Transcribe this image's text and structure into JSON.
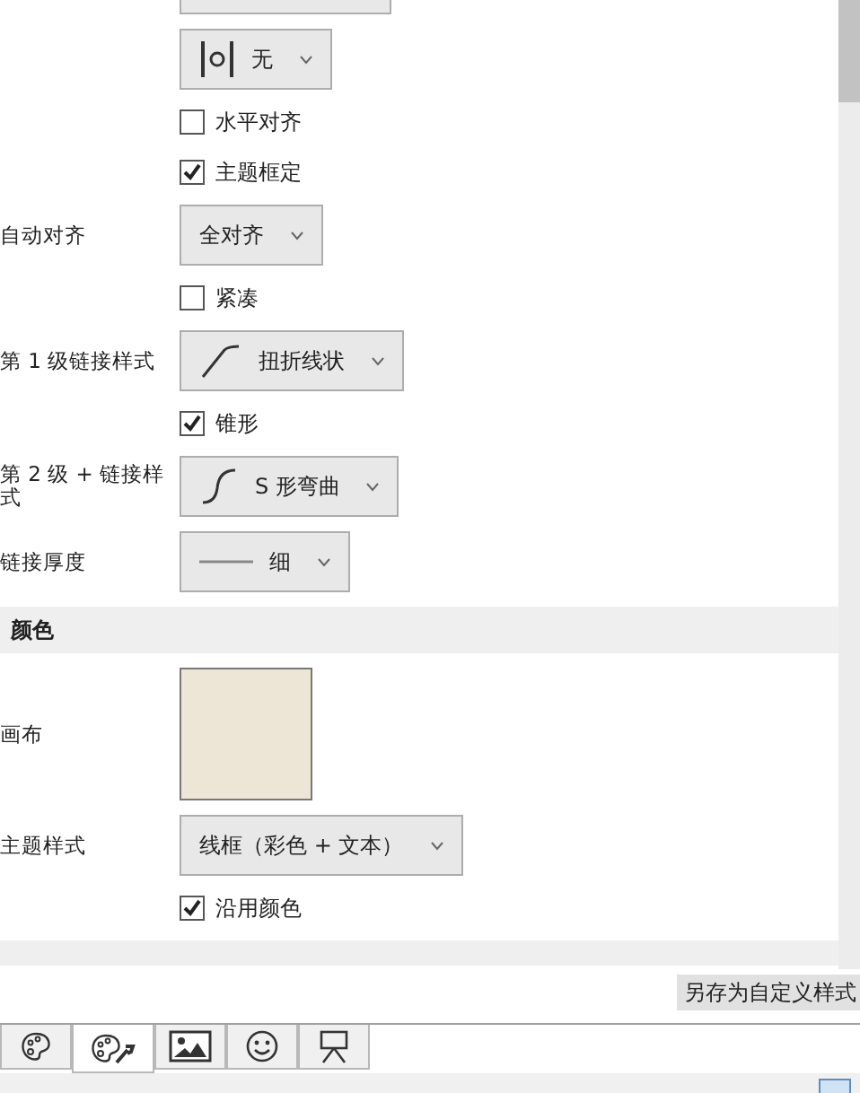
{
  "rows": [
    {
      "kind": "stub"
    },
    {
      "kind": "spacing-select",
      "value": "无"
    },
    {
      "kind": "checkbox",
      "label": "水平对齐",
      "checked": false
    },
    {
      "kind": "checkbox",
      "label": "主题框定",
      "checked": true
    },
    {
      "kind": "text-select",
      "label": "自动对齐",
      "value": "全对齐"
    },
    {
      "kind": "checkbox",
      "label": "紧凑",
      "checked": false
    },
    {
      "kind": "curve-select",
      "label": "第 1 级链接样式",
      "value": "扭折线状"
    },
    {
      "kind": "checkbox",
      "label": "锥形",
      "checked": true
    },
    {
      "kind": "s-curve-select",
      "label": "第 2 级 + 链接样式",
      "value": "S 形弯曲"
    },
    {
      "kind": "line-select",
      "label": "链接厚度",
      "value": "细"
    },
    {
      "kind": "header",
      "label": "颜色"
    },
    {
      "kind": "swatch",
      "label": "画布",
      "color": "#ede6d6"
    },
    {
      "kind": "text-select",
      "label": "主题样式",
      "value": "线框（彩色 + 文本）"
    },
    {
      "kind": "checkbox",
      "label": "沿用颜色",
      "checked": true
    },
    {
      "kind": "header-cut"
    }
  ],
  "save_button": "另存为自定义样式",
  "tabs": [
    {
      "kind": "palette",
      "selected": false
    },
    {
      "kind": "palette-wrench",
      "selected": true
    },
    {
      "kind": "image",
      "selected": false
    },
    {
      "kind": "smiley",
      "selected": false
    },
    {
      "kind": "presentation",
      "selected": false
    }
  ]
}
